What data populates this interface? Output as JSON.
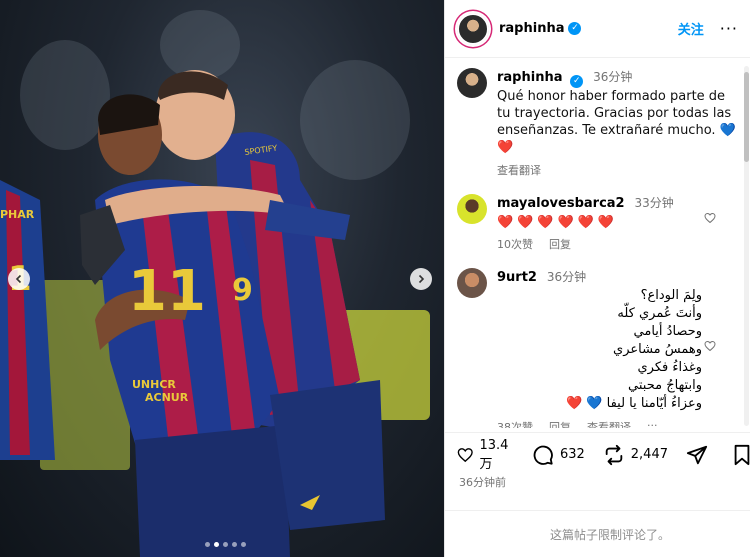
{
  "post": {
    "author": "raphinha",
    "follow_label": "关注",
    "more_label": "···",
    "time_ago": "36分钟前",
    "limited_comments": "这篇帖子限制评论了。"
  },
  "photo": {
    "jersey_number_left": "11",
    "jersey_number_right": "9",
    "sponsor_text": "UNHCR ACNUR",
    "badge_text": "SPOTIFY",
    "side_text": "RAPHI",
    "carousel_count": 5,
    "carousel_active": 1
  },
  "comments": [
    {
      "user": "raphinha",
      "time": "36分钟",
      "verified": true,
      "text": "Qué honor haber formado parte de tu trayectoria. Gracias por todas las enseñanzas. Te extrañaré mucho.",
      "emojis": "💙 ❤️",
      "actions": [
        "查看翻译"
      ]
    },
    {
      "user": "mayalovesbarca2",
      "time": "33分钟",
      "text": "❤️❤️❤️❤️❤️❤️",
      "likes": "10次赞",
      "actions": [
        "回复"
      ]
    },
    {
      "user": "9urt2",
      "time": "36分钟",
      "text_lines": [
        "ولِمَ الوداع؟",
        "وأنتَ عُمري كلّه",
        "وحصادُ أيامي",
        "وهمسُ مشاعري",
        "وغذاءُ فكري",
        "وابتهاجُ محبتي",
        "وعزاءُ أيّامنا يا ليفا"
      ],
      "emojis": "💙 ❤️",
      "likes": "38次赞",
      "actions": [
        "回复",
        "查看翻译",
        "···"
      ]
    }
  ],
  "stats": {
    "likes": "13.4 万",
    "comments": "632",
    "reposts": "2,447"
  },
  "colors": {
    "accent": "#0095f6",
    "heart": "#ed3b55",
    "muted": "#737373"
  }
}
